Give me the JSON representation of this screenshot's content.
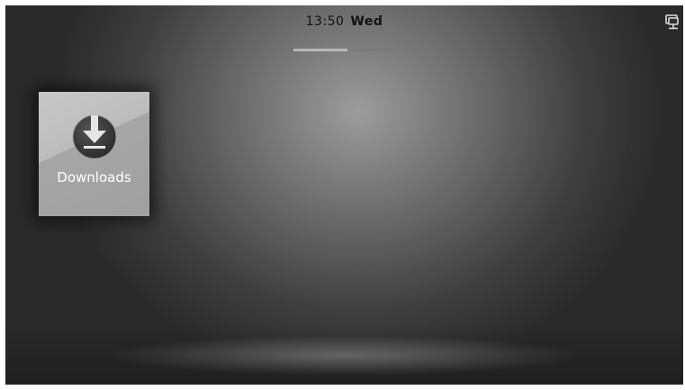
{
  "status_bar": {
    "time": "13:50",
    "day": "Wed",
    "network_icon": "network-monitor-icon"
  },
  "pager": {
    "page_count": 2,
    "current_page": 1
  },
  "home_screen": {
    "folders": [
      {
        "label": "Downloads",
        "icon": "download-icon"
      }
    ]
  }
}
